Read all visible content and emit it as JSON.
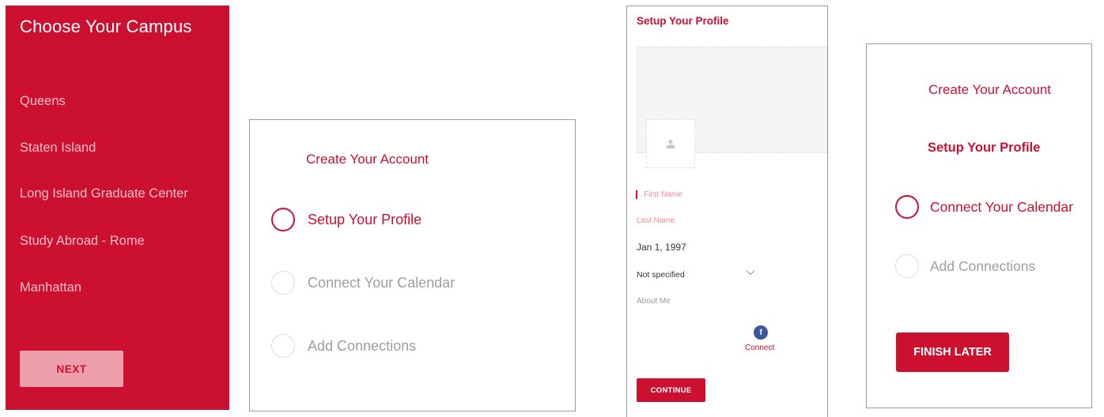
{
  "colors": {
    "brand": "#cc1030",
    "next_bg": "#ec9fab",
    "facebook": "#3b5998",
    "muted": "#9e9e9e"
  },
  "campus_screen": {
    "title": "Choose Your Campus",
    "campuses": [
      "Queens",
      "Staten Island",
      "Long Island Graduate Center",
      "Study Abroad - Rome",
      "Manhattan"
    ],
    "next_label": "NEXT"
  },
  "account_steps_a": {
    "heading": "Create Your Account",
    "steps": [
      {
        "label": "Setup Your Profile",
        "state": "active"
      },
      {
        "label": "Connect Your Calendar",
        "state": "inactive"
      },
      {
        "label": "Add Connections",
        "state": "inactive"
      }
    ]
  },
  "profile_screen": {
    "title": "Setup Your Profile",
    "avatar_icon": "user-silhouette-icon",
    "first_name_placeholder": "First Name",
    "last_name_placeholder": "Last Name",
    "birth_date": "Jan 1, 1997",
    "gender_value": "Not specified",
    "about_placeholder": "About Me",
    "facebook_icon": "f",
    "connect_label": "Connect",
    "continue_label": "CONTINUE"
  },
  "account_steps_b": {
    "heading": "Create Your Account",
    "completed_step": "Setup Your Profile",
    "steps": [
      {
        "label": "Connect Your Calendar",
        "state": "active"
      },
      {
        "label": "Add Connections",
        "state": "inactive"
      }
    ],
    "finish_label": "FINISH LATER"
  }
}
